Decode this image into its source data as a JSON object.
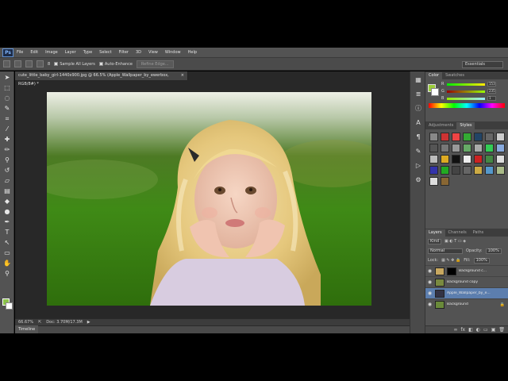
{
  "app": {
    "logo": "Ps"
  },
  "menu": [
    "File",
    "Edit",
    "Image",
    "Layer",
    "Type",
    "Select",
    "Filter",
    "3D",
    "View",
    "Window",
    "Help"
  ],
  "options_bar": {
    "brush_size": "8",
    "sample_all_layers": "Sample All Layers",
    "auto_enhance": "Auto-Enhance",
    "refine_edge": "Refine Edge...",
    "workspace": "Essentials"
  },
  "document": {
    "tab_title": "cute_little_baby_girl-1440x900.jpg @ 66.5% (Apple_Wallpaper_by_ewerbox, RGB/8#) *",
    "zoom": "66.67%",
    "doc_info": "Doc: 3.70M/17.3M"
  },
  "timeline": {
    "label": "Timeline"
  },
  "color_panel": {
    "tabs": [
      "Color",
      "Swatches"
    ],
    "sliders": [
      {
        "label": "R",
        "value": "153"
      },
      {
        "label": "G",
        "value": "235"
      },
      {
        "label": "B",
        "value": "1"
      }
    ],
    "fg_color": "#9bcc3a"
  },
  "adjustments_panel": {
    "tabs": [
      "Adjustments",
      "Styles"
    ]
  },
  "layers_panel": {
    "tabs": [
      "Layers",
      "Channels",
      "Paths"
    ],
    "kind": "Kind",
    "blend_mode": "Normal",
    "opacity_label": "Opacity:",
    "opacity": "100%",
    "lock_label": "Lock:",
    "fill_label": "Fill:",
    "fill": "100%",
    "layers": [
      {
        "name": "Background c..."
      },
      {
        "name": "Background copy"
      },
      {
        "name": "Apple_Wallpaper_by_e..."
      },
      {
        "name": "Background"
      }
    ]
  }
}
